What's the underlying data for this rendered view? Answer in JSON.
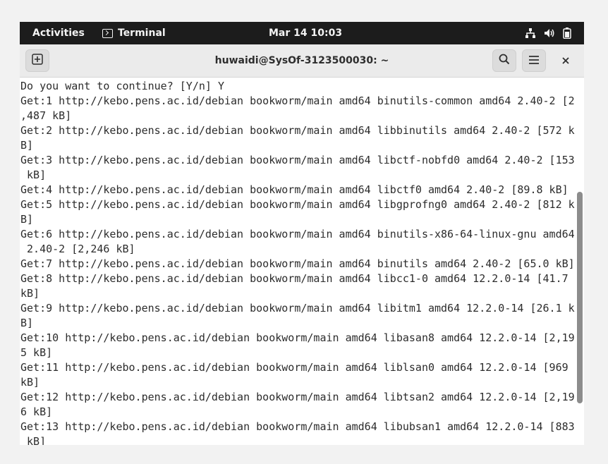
{
  "topbar": {
    "activities_label": "Activities",
    "app_label": "Terminal",
    "clock": "Mar 14  10:03",
    "tray_icons": [
      "network-icon",
      "volume-icon",
      "battery-icon"
    ]
  },
  "headerbar": {
    "title": "huwaidi@SysOf-3123500030: ~",
    "new_tab_icon": "new-tab-icon",
    "search_icon": "search-icon",
    "menu_icon": "hamburger-menu-icon",
    "close_icon": "close-icon"
  },
  "terminal": {
    "lines": [
      "Do you want to continue? [Y/n] Y",
      "Get:1 http://kebo.pens.ac.id/debian bookworm/main amd64 binutils-common amd64 2.40-2 [2",
      ",487 kB]",
      "Get:2 http://kebo.pens.ac.id/debian bookworm/main amd64 libbinutils amd64 2.40-2 [572 k",
      "B]",
      "Get:3 http://kebo.pens.ac.id/debian bookworm/main amd64 libctf-nobfd0 amd64 2.40-2 [153",
      " kB]",
      "Get:4 http://kebo.pens.ac.id/debian bookworm/main amd64 libctf0 amd64 2.40-2 [89.8 kB]",
      "Get:5 http://kebo.pens.ac.id/debian bookworm/main amd64 libgprofng0 amd64 2.40-2 [812 k",
      "B]",
      "Get:6 http://kebo.pens.ac.id/debian bookworm/main amd64 binutils-x86-64-linux-gnu amd64",
      " 2.40-2 [2,246 kB]",
      "Get:7 http://kebo.pens.ac.id/debian bookworm/main amd64 binutils amd64 2.40-2 [65.0 kB]",
      "Get:8 http://kebo.pens.ac.id/debian bookworm/main amd64 libcc1-0 amd64 12.2.0-14 [41.7",
      "kB]",
      "Get:9 http://kebo.pens.ac.id/debian bookworm/main amd64 libitm1 amd64 12.2.0-14 [26.1 k",
      "B]",
      "Get:10 http://kebo.pens.ac.id/debian bookworm/main amd64 libasan8 amd64 12.2.0-14 [2,19",
      "5 kB]",
      "Get:11 http://kebo.pens.ac.id/debian bookworm/main amd64 liblsan0 amd64 12.2.0-14 [969",
      "kB]",
      "Get:12 http://kebo.pens.ac.id/debian bookworm/main amd64 libtsan2 amd64 12.2.0-14 [2,19",
      "6 kB]",
      "Get:13 http://kebo.pens.ac.id/debian bookworm/main amd64 libubsan1 amd64 12.2.0-14 [883",
      " kB]"
    ]
  },
  "colors": {
    "topbar_bg": "#1c1c1c",
    "headerbar_bg": "#ebebeb",
    "terminal_bg": "#ffffff",
    "terminal_fg": "#2c2c2c"
  }
}
